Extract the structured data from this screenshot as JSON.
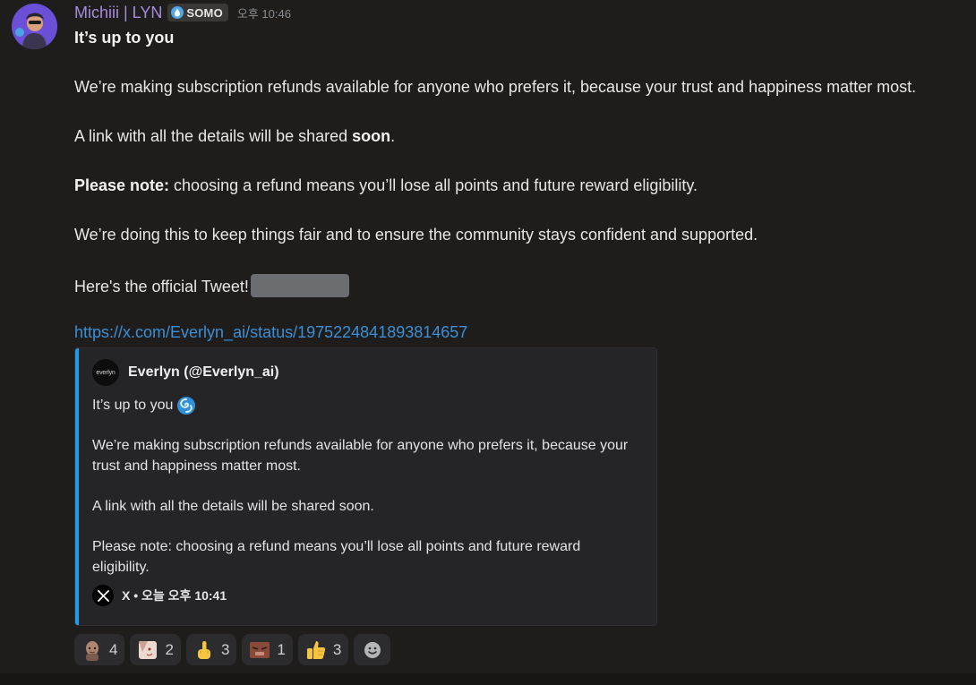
{
  "message": {
    "author": "Michiii | LYN",
    "role_badge": "SOMO",
    "timestamp": "오후 10:46",
    "title": "It’s up to you",
    "line1": "We’re making subscription refunds available for anyone who prefers it, because your trust and happiness matter most.",
    "line2_prefix": "A link with all the details will be shared ",
    "line2_bold": "soon",
    "line2_suffix": ".",
    "line3_bold": "Please note:",
    "line3_rest": " choosing a refund means you’ll lose all points and future reward eligibility.",
    "line4": "We’re doing this to keep things fair and to ensure the community stays confident and supported.",
    "line5": "Here's the official Tweet!",
    "link": "https://x.com/Everlyn_ai/status/1975224841893814657"
  },
  "embed": {
    "author_avatar_text": "everlyn",
    "author": "Everlyn (@Everlyn_ai)",
    "title": "It’s up to you",
    "para1": "We’re making subscription refunds available for anyone who prefers it, because your trust and happiness matter most.",
    "para2": "A link with all the details will be shared soon.",
    "para3": "Please note: choosing a refund means you’ll lose all points and future reward eligibility.",
    "footer": "X • 오늘 오후 10:41",
    "accent_color": "#1e9cf0"
  },
  "reactions": [
    {
      "icon": "bald-man-emoji",
      "count": "4"
    },
    {
      "icon": "anime-face-emoji",
      "count": "2"
    },
    {
      "icon": "middle-finger-emoji",
      "count": "3"
    },
    {
      "icon": "angry-face-emoji",
      "count": "1"
    },
    {
      "icon": "thumbs-up-emoji",
      "count": "3"
    },
    {
      "icon": "add-reaction-icon",
      "count": ""
    }
  ],
  "colors": {
    "username": "#a78bdf",
    "link": "#3b8fd6",
    "background": "#1f1d1b"
  }
}
